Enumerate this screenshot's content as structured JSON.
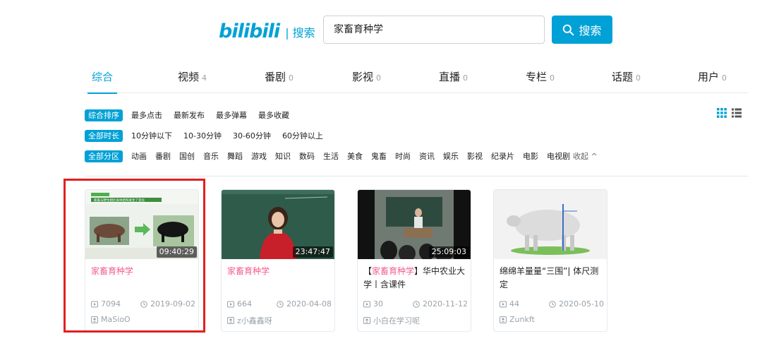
{
  "header": {
    "logo_text": "bilibili",
    "logo_suffix": "| 搜索",
    "search_value": "家畜育种学",
    "search_button": "搜索"
  },
  "tabs": [
    {
      "label": "综合",
      "count": ""
    },
    {
      "label": "视频",
      "count": "4"
    },
    {
      "label": "番剧",
      "count": "0"
    },
    {
      "label": "影视",
      "count": "0"
    },
    {
      "label": "直播",
      "count": "0"
    },
    {
      "label": "专栏",
      "count": "0"
    },
    {
      "label": "话题",
      "count": "0"
    },
    {
      "label": "用户",
      "count": "0"
    }
  ],
  "filters": {
    "sort": {
      "pill": "综合排序",
      "options": [
        "最多点击",
        "最新发布",
        "最多弹幕",
        "最多收藏"
      ]
    },
    "duration": {
      "pill": "全部时长",
      "options": [
        "10分钟以下",
        "10-30分钟",
        "30-60分钟",
        "60分钟以上"
      ]
    },
    "zone": {
      "pill": "全部分区",
      "options": [
        "动画",
        "番剧",
        "国创",
        "音乐",
        "舞蹈",
        "游戏",
        "知识",
        "数码",
        "生活",
        "美食",
        "鬼畜",
        "时尚",
        "资讯",
        "娱乐",
        "影视",
        "纪录片",
        "电影",
        "电视剧"
      ],
      "collapse": "收起 ^"
    }
  },
  "videos": [
    {
      "title_pre": "",
      "title_hl": "家畜育种学",
      "title_post": "",
      "duration": "09:40:29",
      "plays": "7094",
      "date": "2019-09-02",
      "uploader": "MaSioO"
    },
    {
      "title_pre": "",
      "title_hl": "家畜育种学",
      "title_post": "",
      "duration": "23:47:47",
      "plays": "664",
      "date": "2020-04-08",
      "uploader": "z小鑫鑫呀"
    },
    {
      "title_pre": "【",
      "title_hl": "家畜育种学",
      "title_post": "】华中农业大学丨含课件",
      "duration": "25:09:03",
      "plays": "30",
      "date": "2020-11-12",
      "uploader": "小白在学习呢"
    },
    {
      "title_pre": "绵绵羊量量“三围”| 体尺测定",
      "title_hl": "",
      "title_post": "",
      "duration": "",
      "plays": "44",
      "date": "2020-05-10",
      "uploader": "Zunkft"
    }
  ],
  "thumb1_caption": "家畜与野生相比身体结构发生了变化",
  "colors": {
    "accent": "#00a1d6",
    "highlight": "#f25d8e",
    "selection": "#e02020"
  }
}
